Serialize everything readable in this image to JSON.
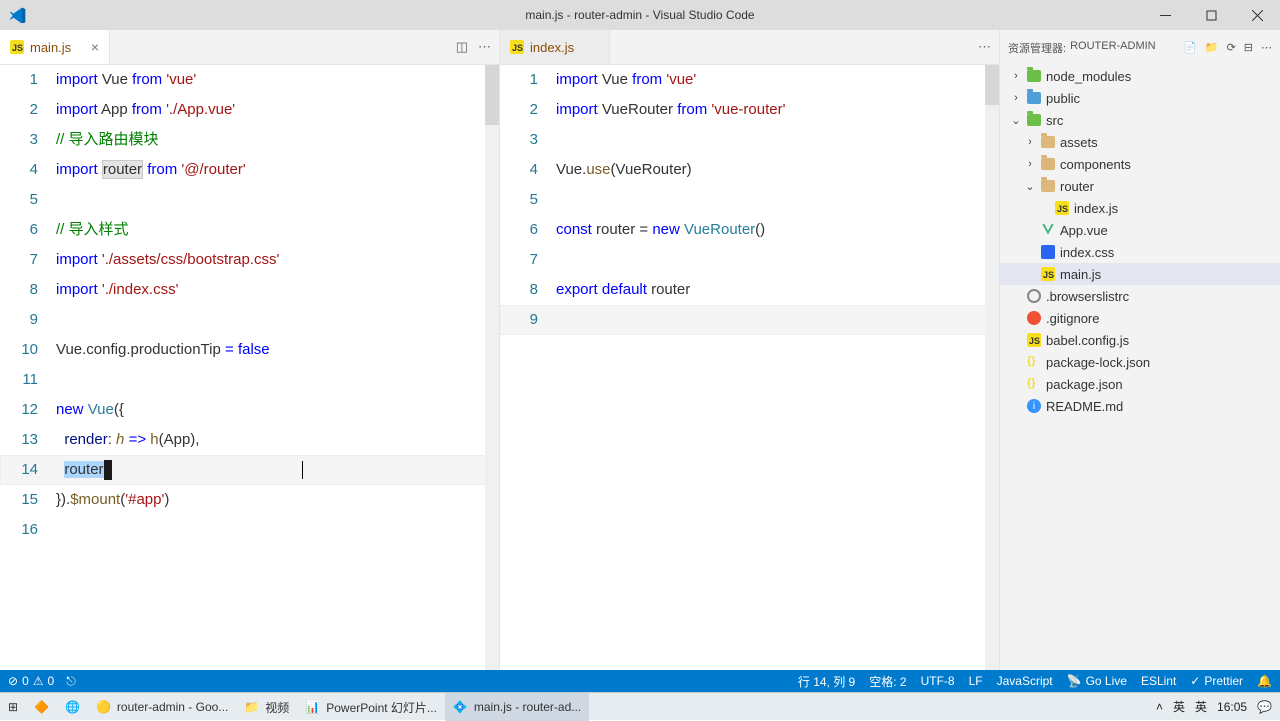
{
  "window": {
    "title": "main.js - router-admin - Visual Studio Code"
  },
  "tabs": {
    "left": {
      "name": "main.js",
      "active": true,
      "dirty": false
    },
    "right": {
      "name": "index.js",
      "active": false,
      "dirty": false
    }
  },
  "explorer": {
    "header_label": "资源管理器:",
    "project": "ROUTER-ADMIN",
    "tree": [
      {
        "indent": 0,
        "chev": "›",
        "type": "folder-green",
        "name": "node_modules"
      },
      {
        "indent": 0,
        "chev": "›",
        "type": "folder-blue",
        "name": "public"
      },
      {
        "indent": 0,
        "chev": "⌄",
        "type": "folder-green",
        "name": "src"
      },
      {
        "indent": 1,
        "chev": "›",
        "type": "folder",
        "name": "assets"
      },
      {
        "indent": 1,
        "chev": "›",
        "type": "folder",
        "name": "components"
      },
      {
        "indent": 1,
        "chev": "⌄",
        "type": "folder",
        "name": "router"
      },
      {
        "indent": 2,
        "chev": "",
        "type": "js",
        "name": "index.js"
      },
      {
        "indent": 1,
        "chev": "",
        "type": "vue",
        "name": "App.vue"
      },
      {
        "indent": 1,
        "chev": "",
        "type": "css",
        "name": "index.css"
      },
      {
        "indent": 1,
        "chev": "",
        "type": "js",
        "name": "main.js",
        "selected": true
      },
      {
        "indent": 0,
        "chev": "",
        "type": "gear",
        "name": ".browserslistrc"
      },
      {
        "indent": 0,
        "chev": "",
        "type": "git",
        "name": ".gitignore"
      },
      {
        "indent": 0,
        "chev": "",
        "type": "js",
        "name": "babel.config.js"
      },
      {
        "indent": 0,
        "chev": "",
        "type": "json",
        "name": "package-lock.json"
      },
      {
        "indent": 0,
        "chev": "",
        "type": "json",
        "name": "package.json"
      },
      {
        "indent": 0,
        "chev": "",
        "type": "info",
        "name": "README.md"
      }
    ]
  },
  "editor_left": {
    "lines": [
      {
        "n": 1,
        "html": "<span class='doc-kw'>import</span> Vue <span class='doc-kw'>from</span> <span class='doc-str'>'vue'</span>"
      },
      {
        "n": 2,
        "html": "<span class='doc-kw'>import</span> App <span class='doc-kw'>from</span> <span class='doc-str'>'./App.vue'</span>"
      },
      {
        "n": 3,
        "html": "<span class='doc-cm'>// 导入路由模块</span>"
      },
      {
        "n": 4,
        "html": "<span class='doc-kw'>import</span> <span class='hl'>router</span> <span class='doc-kw'>from</span> <span class='doc-str'>'@/router'</span>"
      },
      {
        "n": 5,
        "html": ""
      },
      {
        "n": 6,
        "html": "<span class='doc-cm'>// 导入样式</span>"
      },
      {
        "n": 7,
        "html": "<span class='doc-kw'>import</span> <span class='doc-str'>'./assets/css/bootstrap.css'</span>"
      },
      {
        "n": 8,
        "html": "<span class='doc-kw'>import</span> <span class='doc-str'>'./index.css'</span>"
      },
      {
        "n": 9,
        "html": ""
      },
      {
        "n": 10,
        "html": "Vue.config.productionTip <span class='doc-kw'>=</span> <span class='doc-kw'>false</span>"
      },
      {
        "n": 11,
        "html": ""
      },
      {
        "n": 12,
        "html": "<span class='doc-kw'>new</span> <span class='doc-cl'>Vue</span>({"
      },
      {
        "n": 13,
        "html": "  <span class='doc-va'>render</span>: <span style='color:#795e26;font-style:italic'>h</span> <span class='doc-kw'>=&gt;</span> <span class='doc-fn'>h</span>(App),"
      },
      {
        "n": 14,
        "html": "  <span class='sel'>router</span><span class='cursor-box'></span>",
        "active": true
      },
      {
        "n": 15,
        "html": "}).<span class='doc-fn'>$mount</span>(<span class='doc-str'>'#app'</span>)"
      },
      {
        "n": 16,
        "html": ""
      }
    ],
    "text_cursor_x": 302
  },
  "editor_right": {
    "lines": [
      {
        "n": 1,
        "html": "<span class='doc-kw'>import</span> Vue <span class='doc-kw'>from</span> <span class='doc-str'>'vue'</span>"
      },
      {
        "n": 2,
        "html": "<span class='doc-kw'>import</span> VueRouter <span class='doc-kw'>from</span> <span class='doc-str'>'vue-router'</span>"
      },
      {
        "n": 3,
        "html": ""
      },
      {
        "n": 4,
        "html": "Vue.<span class='doc-fn'>use</span>(VueRouter)"
      },
      {
        "n": 5,
        "html": ""
      },
      {
        "n": 6,
        "html": "<span class='doc-kw'>const</span> router = <span class='doc-kw'>new</span> <span class='doc-cl'>VueRouter</span>()"
      },
      {
        "n": 7,
        "html": ""
      },
      {
        "n": 8,
        "html": "<span class='doc-kw'>export</span> <span class='doc-kw'>default</span> router"
      },
      {
        "n": 9,
        "html": "",
        "active": true
      }
    ]
  },
  "status": {
    "errors": "0",
    "warnings": "0",
    "ln_col": "行 14, 列 9",
    "spaces": "空格: 2",
    "encoding": "UTF-8",
    "eol": "LF",
    "lang": "JavaScript",
    "golive": "Go Live",
    "eslint": "ESLint",
    "prettier": "Prettier"
  },
  "taskbar": {
    "items": [
      {
        "label": "",
        "icon": "win"
      },
      {
        "label": "",
        "icon": "app1"
      },
      {
        "label": "",
        "icon": "edge"
      },
      {
        "label": "router-admin - Goo...",
        "icon": "chrome",
        "active": false
      },
      {
        "label": "视频",
        "icon": "folder"
      },
      {
        "label": "PowerPoint 幻灯片...",
        "icon": "ppt"
      },
      {
        "label": "main.js - router-ad...",
        "icon": "vscode",
        "active": true
      }
    ],
    "tray": {
      "ime1": "英",
      "ime2": "英",
      "time": "16:05"
    }
  }
}
